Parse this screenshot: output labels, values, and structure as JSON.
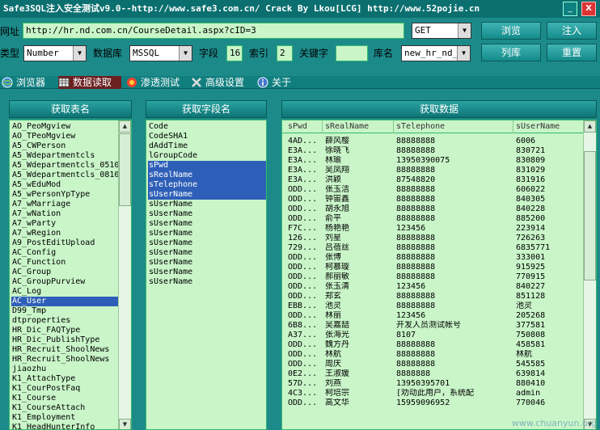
{
  "window": {
    "title": "Safe3SQL注入安全测试v9.0--http://www.safe3.com.cn/   Crack By Lkou[LCG]  http://www.52pojie.cn",
    "minimize_label": "_",
    "close_label": "X"
  },
  "toolbar": {
    "url_label": "网址",
    "url_value": "http://hr.nd.com.cn/CourseDetail.aspx?cID=3",
    "method_value": "GET",
    "browse_label": "浏览",
    "inject_label": "注入",
    "type_label": "类型",
    "type_value": "Number",
    "db_label": "数据库",
    "db_value": "MSSQL",
    "field_label": "字段",
    "field_value": "16",
    "index_label": "索引",
    "index_value": "2",
    "keyword_label": "关键字",
    "keyword_value": "",
    "dbname_label": "库名",
    "dbname_value": "new_hr_nd_d",
    "list_label": "列库",
    "reset_label": "重置"
  },
  "tabs": [
    {
      "label": "浏览器",
      "icon": "globe-icon"
    },
    {
      "label": "数据读取",
      "icon": "grid-icon"
    },
    {
      "label": "渗透测试",
      "icon": "swirl-icon"
    },
    {
      "label": "高级设置",
      "icon": "tools-icon"
    },
    {
      "label": "关于",
      "icon": "info-icon"
    }
  ],
  "tables_panel": {
    "title": "获取表名",
    "items": [
      "AO_PeoMgview",
      "AO_TPeoMgview",
      "A5_CWPerson",
      "A5_Wdepartmentcls",
      "A5_Wdepartmentcls_0510",
      "A5_Wdepartmentcls_0810",
      "A5_wEduMod",
      "A5_wPersonYpType",
      "A7_wMarriage",
      "A7_wNation",
      "A7_wParty",
      "A7_wRegion",
      "A9_PostEditUpload",
      "AC_Config",
      "AC_Function",
      "AC_Group",
      "AC_GroupPurview",
      "AC_Log",
      "AC_User",
      "D99_Tmp",
      "dtproperties",
      "HR_Dic_FAQType",
      "HR_Dic_PublishType",
      "HR_Recruit_ShoolNews",
      "HR_Recruit_ShoolNews",
      "jiaozhu",
      "K1_AttachType",
      "K1_CourPostFaq",
      "K1_Course",
      "K1_CourseAttach",
      "K1_Employment",
      "K1_HeadHunterInfo"
    ],
    "selected_index": 18
  },
  "fields_panel": {
    "title": "获取字段名",
    "items": [
      "Code",
      "CodeSHA1",
      "dAddTime",
      "lGroupCode",
      "sPwd",
      "sRealName",
      "sTelephone",
      "sUserName",
      "sUserName",
      "sUserName",
      "sUserName",
      "sUserName",
      "sUserName",
      "sUserName",
      "sUserName",
      "sUserName",
      "sUserName"
    ],
    "selected_indices": [
      4,
      5,
      6,
      7
    ]
  },
  "data_panel": {
    "title": "获取数据",
    "columns": [
      "sPwd",
      "sRealName",
      "sTelephone",
      "sUserName"
    ],
    "rows": [
      [
        "4AD...",
        "薛风樱",
        "88888888",
        "6006"
      ],
      [
        "E3A...",
        "徐晓飞",
        "88888888",
        "830721"
      ],
      [
        "E3A...",
        "林瑜",
        "13950390075",
        "830809"
      ],
      [
        "E3A...",
        "吴凤翔",
        "88888888",
        "831029"
      ],
      [
        "E3A...",
        "洪颖",
        "87548820",
        "831916"
      ],
      [
        "ODD...",
        "张玉洁",
        "88888888",
        "606022"
      ],
      [
        "ODD...",
        "钟宙鑫",
        "88888888",
        "840305"
      ],
      [
        "ODD...",
        "胡永旭",
        "88888888",
        "840228"
      ],
      [
        "ODD...",
        "俞平",
        "88888888",
        "885200"
      ],
      [
        "F7C...",
        "杨艳艳",
        "123456",
        "223914"
      ],
      [
        "126...",
        "刘星",
        "88888888",
        "726263"
      ],
      [
        "729...",
        "吕蓓丝",
        "88888888",
        "6835771"
      ],
      [
        "ODD...",
        "张博",
        "88888888",
        "333001"
      ],
      [
        "ODD...",
        "柯慕璇",
        "88888888",
        "915925"
      ],
      [
        "ODD...",
        "郝丽敏",
        "88888888",
        "770915"
      ],
      [
        "ODD...",
        "张玉清",
        "123456",
        "840227"
      ],
      [
        "ODD...",
        "郑玄",
        "88888888",
        "851128"
      ],
      [
        "EBB...",
        "池灵",
        "88888888",
        "池灵"
      ],
      [
        "ODD...",
        "林丽",
        "123456",
        "205268"
      ],
      [
        "6B8...",
        "吴嘉喆",
        "开发人员测试帐号",
        "377581"
      ],
      [
        "A37...",
        "张海光",
        "8107",
        "750808"
      ],
      [
        "ODD...",
        "魏方丹",
        "88888888",
        "458581"
      ],
      [
        "ODD...",
        "林航",
        "88888888",
        "林航"
      ],
      [
        "ODD...",
        "周庆",
        "88888888",
        "545585"
      ],
      [
        "0E2...",
        "王淑媛",
        "8888888",
        "639814"
      ],
      [
        "57D...",
        "刘燕",
        "13950395701",
        "880410"
      ],
      [
        "4C3...",
        "柯培宗",
        "[劝动此用户，系统配",
        "admin"
      ],
      [
        "ODD...",
        "高文华",
        "15959096952",
        "770046"
      ]
    ]
  },
  "watermark": "www.chuanyun.org"
}
